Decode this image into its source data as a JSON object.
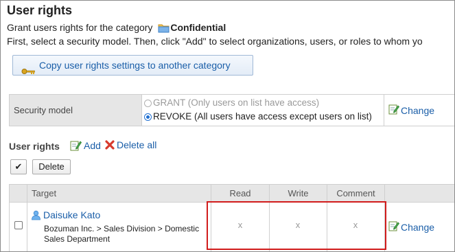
{
  "page": {
    "title": "User rights",
    "intro_prefix": "Grant users rights for the category",
    "category_name": "Confidential",
    "instructions": "First, select a security model. Then, click \"Add\" to select organizations, users, or roles to whom yo"
  },
  "copy_button": {
    "label": "Copy user rights settings to another category",
    "icon": "key-icon"
  },
  "security_model": {
    "header": "Security model",
    "options": [
      {
        "label": "GRANT (Only users on list have access)",
        "selected": false,
        "enabled": false
      },
      {
        "label": "REVOKE (All users have access except users on list)",
        "selected": true,
        "enabled": true
      }
    ],
    "change_label": "Change"
  },
  "user_rights": {
    "section_title": "User rights",
    "add_label": "Add",
    "delete_all_label": "Delete all",
    "check_all_symbol": "✔",
    "delete_label": "Delete",
    "columns": {
      "target": "Target",
      "read": "Read",
      "write": "Write",
      "comment": "Comment"
    },
    "rows": [
      {
        "name": "Daisuke Kato",
        "org_path": "Bozuman Inc. > Sales Division > Domestic Sales Department",
        "read": "x",
        "write": "x",
        "comment": "x",
        "change_label": "Change"
      }
    ]
  },
  "colors": {
    "link": "#1a5ea8",
    "highlight": "#d11b1b",
    "header_bg": "#e6e6e6"
  }
}
